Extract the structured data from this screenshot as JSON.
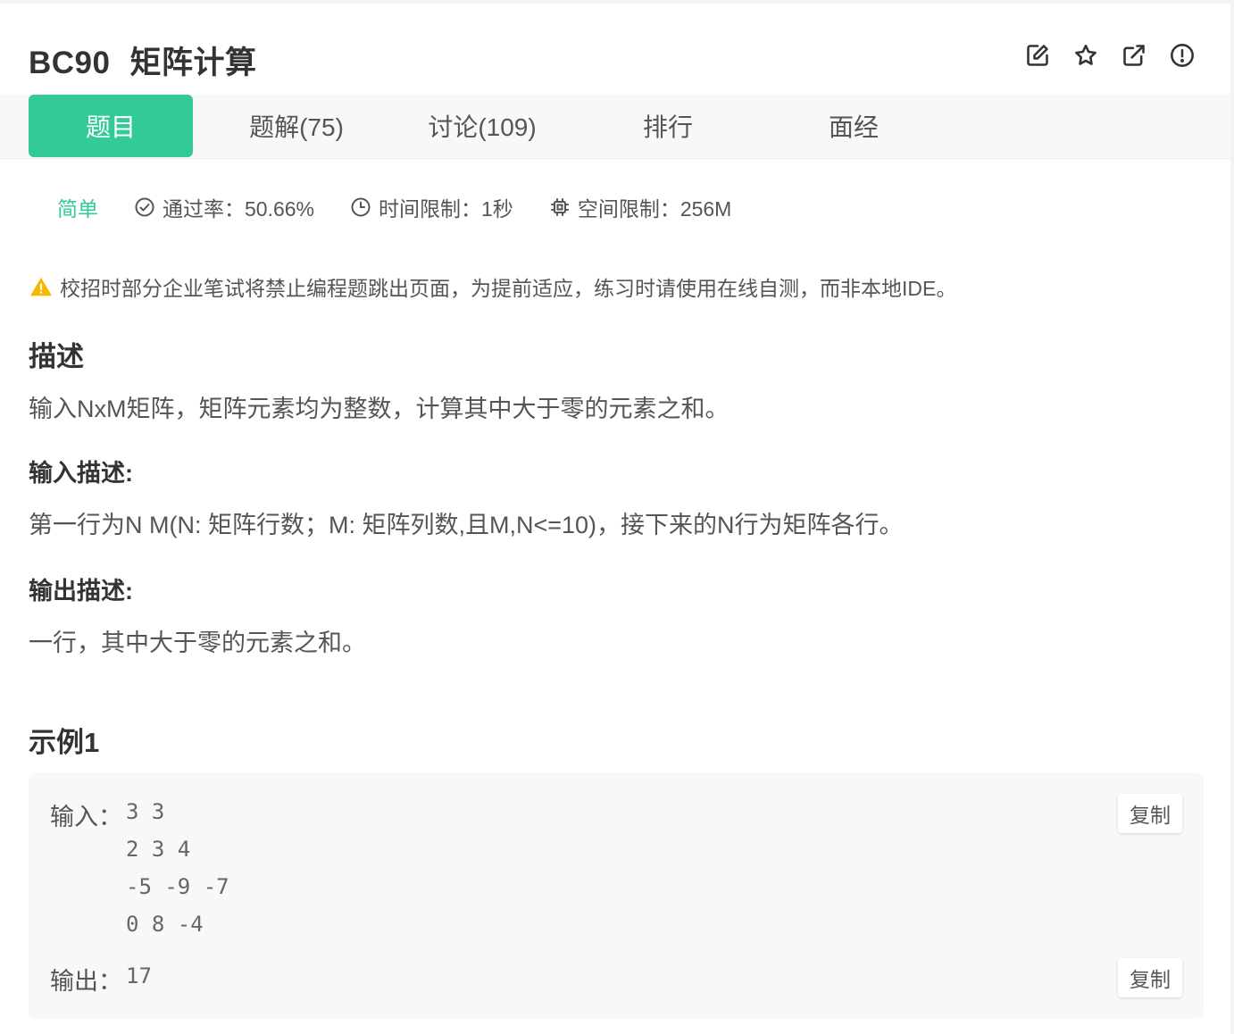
{
  "header": {
    "problem_code": "BC90",
    "problem_name": "矩阵计算",
    "icons": [
      "edit-icon",
      "star-icon",
      "external-link-icon",
      "report-icon"
    ]
  },
  "tabs": [
    {
      "label": "题目",
      "active": true
    },
    {
      "label": "题解(75)",
      "active": false
    },
    {
      "label": "讨论(109)",
      "active": false
    },
    {
      "label": "排行",
      "active": false
    },
    {
      "label": "面经",
      "active": false
    }
  ],
  "meta": {
    "difficulty": "简单",
    "pass_rate": "通过率：50.66%",
    "time_limit": "时间限制：1秒",
    "memory_limit": "空间限制：256M"
  },
  "notice": "校招时部分企业笔试将禁止编程题跳出页面，为提前适应，练习时请使用在线自测，而非本地IDE。",
  "description": {
    "title": "描述",
    "text": "输入NxM矩阵，矩阵元素均为整数，计算其中大于零的元素之和。"
  },
  "input_desc": {
    "title": "输入描述:",
    "text": "第一行为N M(N: 矩阵行数；M: 矩阵列数,且M,N<=10)，接下来的N行为矩阵各行。"
  },
  "output_desc": {
    "title": "输出描述:",
    "text": "一行，其中大于零的元素之和。"
  },
  "example": {
    "title": "示例1",
    "input_label": "输入：",
    "input_lines": [
      "3 3",
      "2 3 4",
      "-5 -9 -7",
      "0 8 -4"
    ],
    "output_label": "输出：",
    "output_value": "17",
    "copy_label": "复制"
  },
  "colors": {
    "accent": "#32ca99",
    "warning": "#f5b800"
  }
}
